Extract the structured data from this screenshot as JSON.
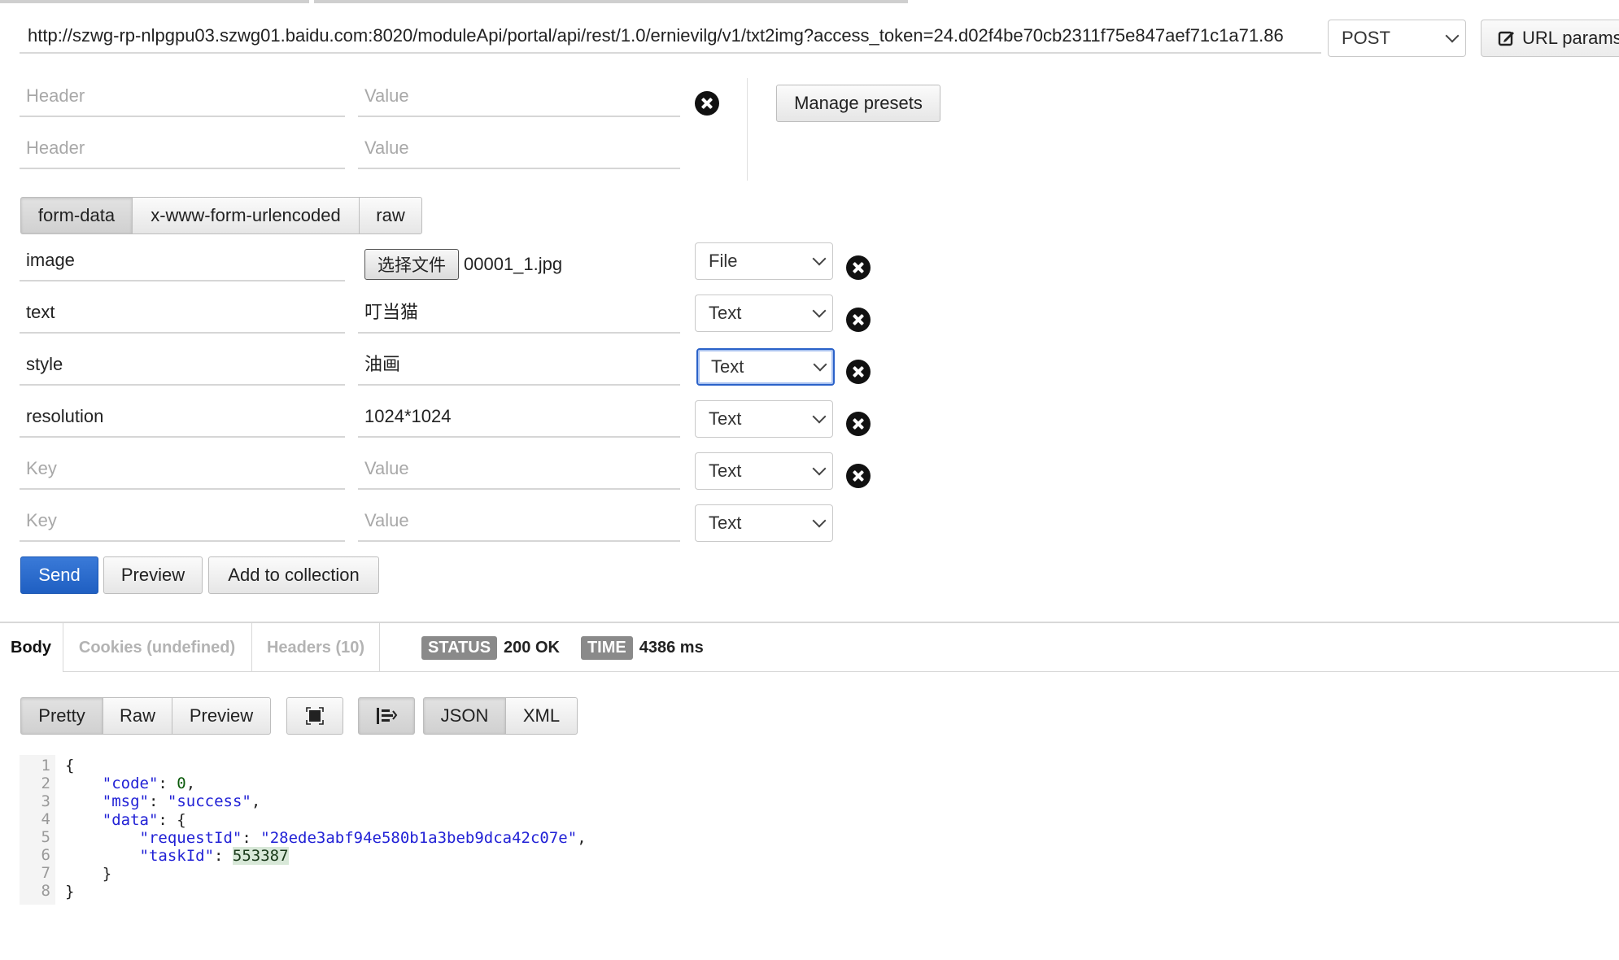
{
  "request": {
    "url": "http://szwg-rp-nlpgpu03.szwg01.baidu.com:8020/moduleApi/portal/api/rest/1.0/ernievilg/v1/txt2img?access_token=24.d02f4be70cb2311f75e847aef71c1a71.86",
    "method": "POST",
    "url_params_label": "URL params",
    "manage_presets_label": "Manage presets"
  },
  "headers": [
    {
      "header_placeholder": "Header",
      "value_placeholder": "Value"
    },
    {
      "header_placeholder": "Header",
      "value_placeholder": "Value"
    }
  ],
  "body_tabs": [
    "form-data",
    "x-www-form-urlencoded",
    "raw"
  ],
  "form_rows": [
    {
      "key": "image",
      "value": "",
      "file_button": "选择文件",
      "file_name": "00001_1.jpg",
      "type": "File"
    },
    {
      "key": "text",
      "value": "叮当猫",
      "type": "Text"
    },
    {
      "key": "style",
      "value": "油画",
      "type": "Text"
    },
    {
      "key": "resolution",
      "value": "1024*1024",
      "type": "Text"
    },
    {
      "key_placeholder": "Key",
      "value_placeholder": "Value",
      "type": "Text"
    },
    {
      "key_placeholder": "Key",
      "value_placeholder": "Value",
      "type": "Text"
    }
  ],
  "actions": {
    "send": "Send",
    "preview": "Preview",
    "add_to_collection": "Add to collection"
  },
  "response": {
    "tabs": [
      "Body",
      "Cookies (undefined)",
      "Headers (10)"
    ],
    "status_label": "STATUS",
    "status_value": "200 OK",
    "time_label": "TIME",
    "time_value": "4386 ms",
    "view_tabs": [
      "Pretty",
      "Raw",
      "Preview"
    ],
    "format_tabs": [
      "JSON",
      "XML"
    ],
    "line_numbers": [
      "1",
      "2",
      "3",
      "4",
      "5",
      "6",
      "7",
      "8"
    ],
    "body": {
      "code": 0,
      "msg": "success",
      "requestId": "28ede3abf94e580b1a3beb9dca42c07e",
      "taskId": 553387
    }
  },
  "colors": {
    "accent": "#2563c9",
    "badge": "#8a8a8a",
    "json_key": "#2222d6"
  }
}
